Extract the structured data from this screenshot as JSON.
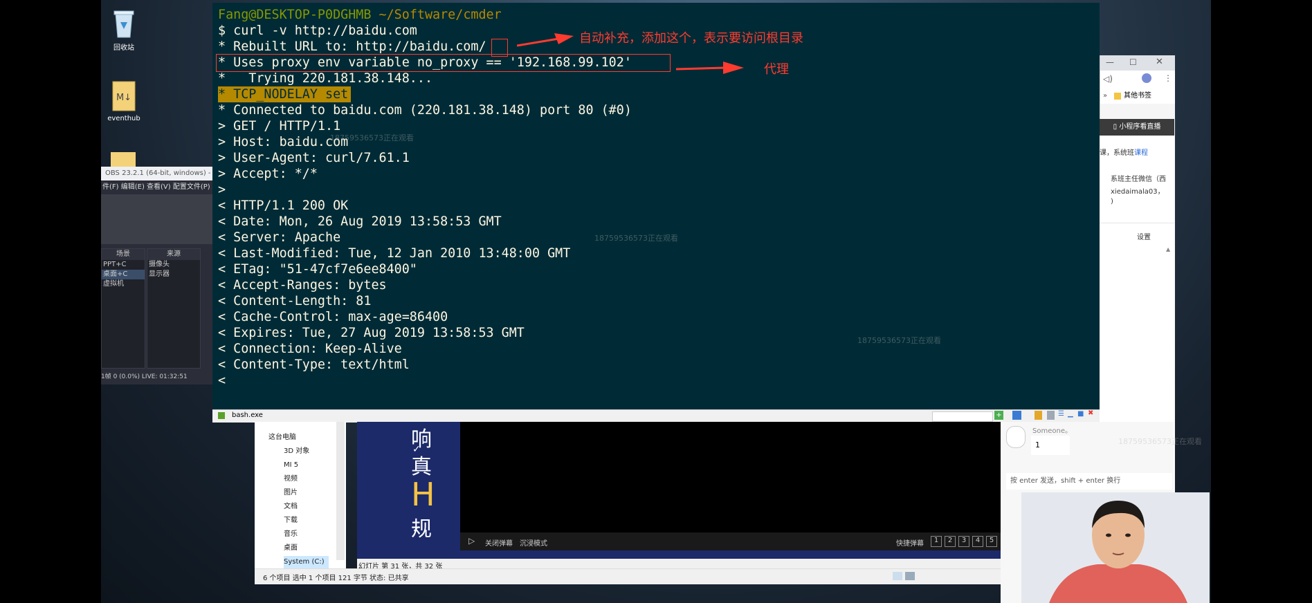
{
  "desktop": {
    "icons": [
      {
        "label": "回收站",
        "icon": "recycle-bin-icon"
      },
      {
        "label": "eventhub",
        "icon": "markdown-file-icon"
      }
    ]
  },
  "obs": {
    "title": "OBS 23.2.1 (64-bit, windows) - 配",
    "menu": "件(F)  编辑(E)  查看(V)  配置文件(P)",
    "scenes_header": "场景",
    "sources_header": "来源",
    "scenes": [
      "PPT+C",
      "桌面+C",
      "虚拟机"
    ],
    "sources": [
      "摄像头",
      "显示器"
    ],
    "status": "1帧 0 (0.0%)     LIVE: 01:32:51"
  },
  "terminal": {
    "title_user": "Fang@DESKTOP-P0DGHMB",
    "title_path": "~/Software/cmder",
    "lines": [
      "$ curl -v http://baidu.com",
      "* Rebuilt URL to: http://baidu.com/",
      "* Uses proxy env variable no_proxy == '192.168.99.102'",
      "*   Trying 220.181.38.148...",
      "* TCP_NODELAY set",
      "* Connected to baidu.com (220.181.38.148) port 80 (#0)",
      "> GET / HTTP/1.1",
      "> Host: baidu.com",
      "> User-Agent: curl/7.61.1",
      "> Accept: */*",
      ">",
      "< HTTP/1.1 200 OK",
      "< Date: Mon, 26 Aug 2019 13:58:53 GMT",
      "< Server: Apache",
      "< Last-Modified: Tue, 12 Jan 2010 13:48:00 GMT",
      "< ETag: \"51-47cf7e6ee8400\"",
      "< Accept-Ranges: bytes",
      "< Content-Length: 81",
      "< Cache-Control: max-age=86400",
      "< Expires: Tue, 27 Aug 2019 13:58:53 GMT",
      "< Connection: Keep-Alive",
      "< Content-Type: text/html",
      "<"
    ],
    "tab_label": "bash.exe",
    "annotation_1": "自动补充，添加这个，表示要访问根目录",
    "annotation_2": "代理",
    "highlight_color": "#b58900",
    "annotation_color": "#ff3b2f"
  },
  "watermark": "18759536573正在观看",
  "browser": {
    "bookmark": "其他书签",
    "mini_live": "小程序看直播",
    "text1": "课，系统班",
    "text1_link": "课程",
    "text2": "系班主任微信（西",
    "text3": "xiedaimala03，",
    "text4": ")",
    "settings": "设置"
  },
  "explorer": {
    "items": [
      "这台电脑",
      "3D 对象",
      "MI 5",
      "视频",
      "图片",
      "文档",
      "下载",
      "音乐",
      "桌面",
      "System (C:)"
    ],
    "status": "6 个项目    选中 1 个项目  121 字节    状态:  已共享"
  },
  "ppt": {
    "bullets": [
      "响",
      "真",
      "H",
      "规"
    ],
    "slide_status": "幻灯片 第 31 张，共 32 张"
  },
  "video": {
    "danmaku_off": "关闭弹幕",
    "immersive": "沉浸模式",
    "quick_danmaku": "快捷弹幕",
    "quick_buttons": [
      "1",
      "2",
      "3",
      "4",
      "5"
    ]
  },
  "chat": {
    "someone": "Someone。",
    "count": "1",
    "input_placeholder": "按 enter 发送，shift + enter 换行"
  }
}
